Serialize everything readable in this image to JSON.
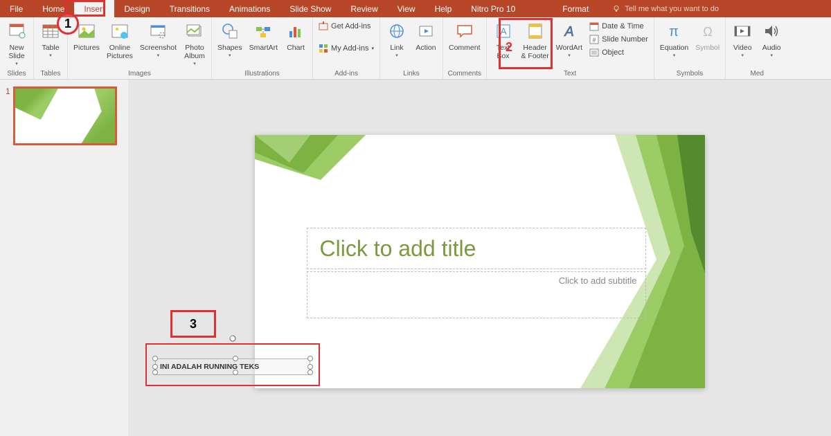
{
  "tabs": {
    "file": "File",
    "home": "Home",
    "insert": "Insert",
    "design": "Design",
    "transitions": "Transitions",
    "animations": "Animations",
    "slideshow": "Slide Show",
    "review": "Review",
    "view": "View",
    "help": "Help",
    "nitro": "Nitro Pro 10",
    "format": "Format",
    "tellme": "Tell me what you want to do"
  },
  "ribbon": {
    "slides": {
      "new_slide": "New\nSlide",
      "group": "Slides"
    },
    "tables": {
      "table": "Table",
      "group": "Tables"
    },
    "images": {
      "pictures": "Pictures",
      "online_pictures": "Online\nPictures",
      "screenshot": "Screenshot",
      "photo_album": "Photo\nAlbum",
      "group": "Images"
    },
    "illustrations": {
      "shapes": "Shapes",
      "smartart": "SmartArt",
      "chart": "Chart",
      "group": "Illustrations"
    },
    "addins": {
      "get": "Get Add-ins",
      "my": "My Add-ins",
      "group": "Add-ins"
    },
    "links": {
      "link": "Link",
      "action": "Action",
      "group": "Links"
    },
    "comments": {
      "comment": "Comment",
      "group": "Comments"
    },
    "text": {
      "textbox": "Text\nBox",
      "header_footer": "Header\n& Footer",
      "wordart": "WordArt",
      "date_time": "Date & Time",
      "slide_number": "Slide Number",
      "object": "Object",
      "group": "Text"
    },
    "symbols": {
      "equation": "Equation",
      "symbol": "Symbol",
      "group": "Symbols"
    },
    "media": {
      "video": "Video",
      "audio": "Audio",
      "group": "Med"
    }
  },
  "thumb": {
    "num": "1"
  },
  "slide": {
    "title_placeholder": "Click to add title",
    "subtitle_placeholder": "Click to add subtitle"
  },
  "textbox": {
    "content": "INI ADALAH RUNNING TEKS"
  },
  "callouts": {
    "one": "1",
    "two": "2",
    "three": "3"
  },
  "colors": {
    "accent": "#b8472a",
    "annotation": "#e03030",
    "slide_green": "#7cb342"
  }
}
